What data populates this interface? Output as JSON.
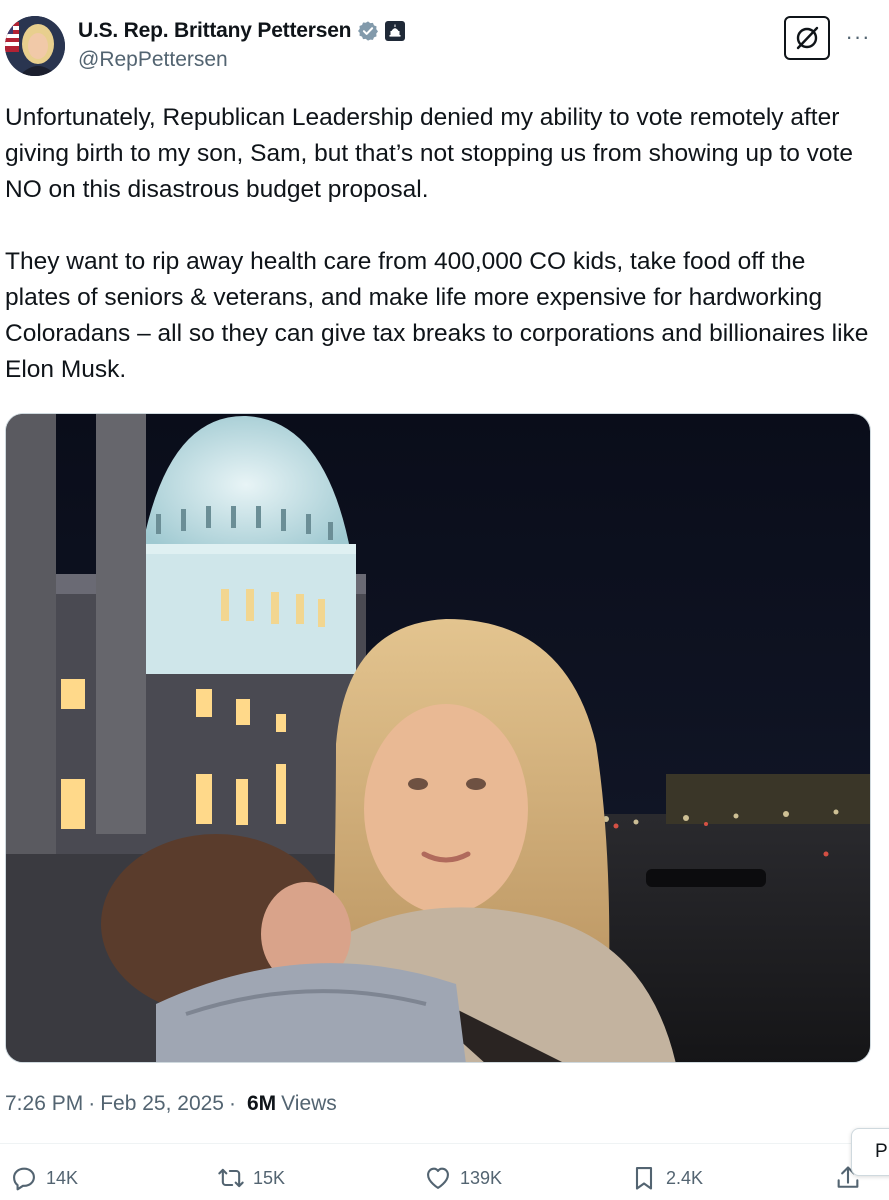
{
  "author": {
    "display_name": "U.S. Rep. Brittany Pettersen",
    "handle": "@RepPettersen",
    "verified_icon": "verified-badge-icon",
    "affiliation_icon": "government-capitol-badge-icon"
  },
  "header_buttons": {
    "grok_icon": "grok-icon",
    "more": "···"
  },
  "tweet": {
    "paragraphs": [
      "Unfortunately, Republican Leadership denied my ability to vote remotely after giving birth to my son, Sam, but that’s not stopping us from showing up to vote NO on this disastrous budget proposal.",
      "They want to rip away health care from 400,000 CO kids, take food off the plates of seniors & veterans, and make life more expensive for hardworking Coloradans – all so they can give tax breaks to corporations and billionaires like Elon Musk."
    ]
  },
  "meta": {
    "time": "7:26 PM",
    "separator": "·",
    "date": "Feb 25, 2025",
    "views_count": "6M",
    "views_label": "Views"
  },
  "actions": {
    "replies": "14K",
    "reposts": "15K",
    "likes": "139K",
    "bookmarks": "2.4K"
  },
  "popup": {
    "label": "P"
  },
  "colors": {
    "text": "#0f1419",
    "secondary": "#536471",
    "verified": "#829aab"
  }
}
